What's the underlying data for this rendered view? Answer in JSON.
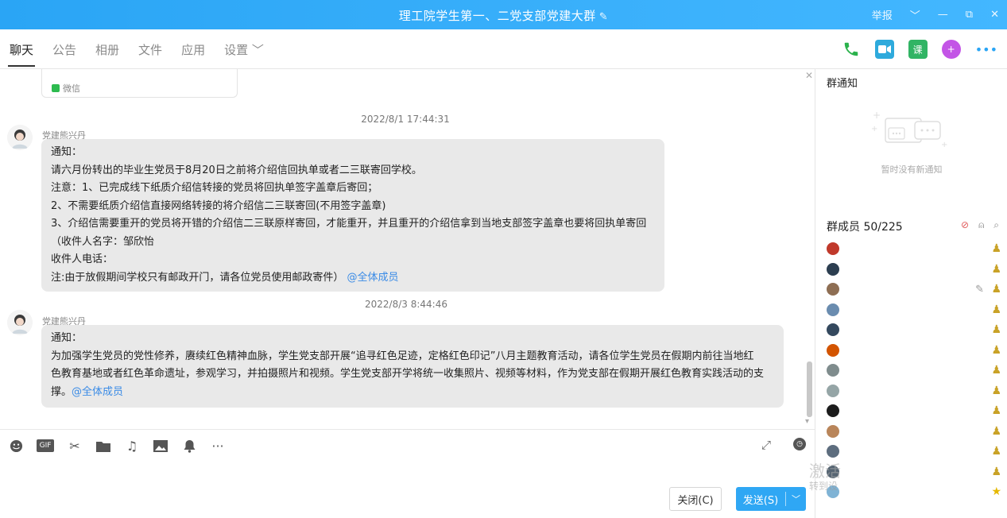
{
  "window": {
    "title": "理工院学生第一、二党支部党建大群",
    "controls": [
      "举报",
      "﹀",
      "—",
      "⧉",
      "✕"
    ]
  },
  "tabs": [
    {
      "label": "聊天",
      "active": true
    },
    {
      "label": "公告"
    },
    {
      "label": "相册"
    },
    {
      "label": "文件"
    },
    {
      "label": "应用"
    },
    {
      "label": "设置 ﹀"
    }
  ],
  "toolbar_icons": [
    "phone-call-icon",
    "video-call-icon",
    "class-icon",
    "add-app-icon",
    "more-icon"
  ],
  "toolbar_icon_labels": {
    "class": "课"
  },
  "prev_card": {
    "source": "微信"
  },
  "messages": [
    {
      "time": "2022/8/1 17:44:31",
      "sender": "党建熊兴丹",
      "lines": [
        "通知：",
        "请六月份转出的毕业生党员于8月20日之前将介绍信回执单或者二三联寄回学校。",
        "注意：1、已完成线下纸质介绍信转接的党员将回执单签字盖章后寄回；",
        "2、不需要纸质介绍信直接网络转接的将介绍信二三联寄回(不用签字盖章)",
        "3、介绍信需要重开的党员将开错的介绍信二三联原样寄回，才能重开，并且重开的介绍信拿到当地支部签字盖章也要将回执单寄回",
        "（收件人名字：邹欣怡",
        "收件人电话："
      ],
      "last_line": "注:由于放假期间学校只有邮政开门，请各位党员使用邮政寄件）",
      "mention": "@全体成员"
    },
    {
      "time": "2022/8/3 8:44:46",
      "sender": "党建熊兴丹",
      "lines": [
        "通知：",
        "为加强学生党员的党性修养，赓续红色精神血脉，学生党支部开展“追寻红色足迹，定格红色印记”八月主题教育活动，请各位学生党员在假期内前往当地红",
        "色教育基地或者红色革命遗址，参观学习，并拍摄照片和视频。学生党支部开学将统一收集照片、视频等材料，作为党支部在假期开展红色教育实践活动的支"
      ],
      "last_line": "撑。",
      "mention": "@全体成员"
    }
  ],
  "input_tools": [
    "emoji-icon",
    "gif-icon",
    "scissors-icon",
    "folder-icon",
    "music-icon",
    "image-icon",
    "bell-icon",
    "more-icon"
  ],
  "input_tool_labels": {
    "gif": "GIF",
    "more": "···"
  },
  "buttons": {
    "close": "关闭(C)",
    "send": "发送(S)",
    "send_arrow": "﹀"
  },
  "right_panel": {
    "notice_title": "群通知",
    "notice_empty": "暂时没有新通知",
    "members_title": "群成员 50/225",
    "members": [
      {
        "avatar_color": "#c0392b",
        "badge": "person",
        "badge_color": "#c9a227"
      },
      {
        "avatar_color": "#2c3e50",
        "badge": "person",
        "badge_color": "#c9a227"
      },
      {
        "avatar_color": "#8e6e53",
        "badge": "person",
        "badge_color": "#c9a227",
        "editable": true
      },
      {
        "avatar_color": "#6a8caf",
        "badge": "person",
        "badge_color": "#c9a227"
      },
      {
        "avatar_color": "#34495e",
        "badge": "person",
        "badge_color": "#c9a227"
      },
      {
        "avatar_color": "#d35400",
        "badge": "person",
        "badge_color": "#c9a227"
      },
      {
        "avatar_color": "#7f8c8d",
        "badge": "person",
        "badge_color": "#c9a227"
      },
      {
        "avatar_color": "#95a5a6",
        "badge": "person",
        "badge_color": "#c9a227"
      },
      {
        "avatar_color": "#1c1c1c",
        "badge": "person",
        "badge_color": "#c9a227"
      },
      {
        "avatar_color": "#b9855a",
        "badge": "person",
        "badge_color": "#c9a227"
      },
      {
        "avatar_color": "#5d6d7e",
        "badge": "person",
        "badge_color": "#c9a227"
      },
      {
        "avatar_color": "#566573",
        "badge": "person",
        "badge_color": "#c9a227"
      },
      {
        "avatar_color": "#7fb3d5",
        "badge": "star",
        "badge_color": "#e5b800"
      }
    ]
  },
  "watermark": {
    "line1": "激活",
    "line2": "转到设"
  },
  "colors": {
    "titlebar": "#2aa5f5",
    "send": "#2fa7f4",
    "mention": "#3a8be6",
    "bubble": "#e9e9e9"
  }
}
